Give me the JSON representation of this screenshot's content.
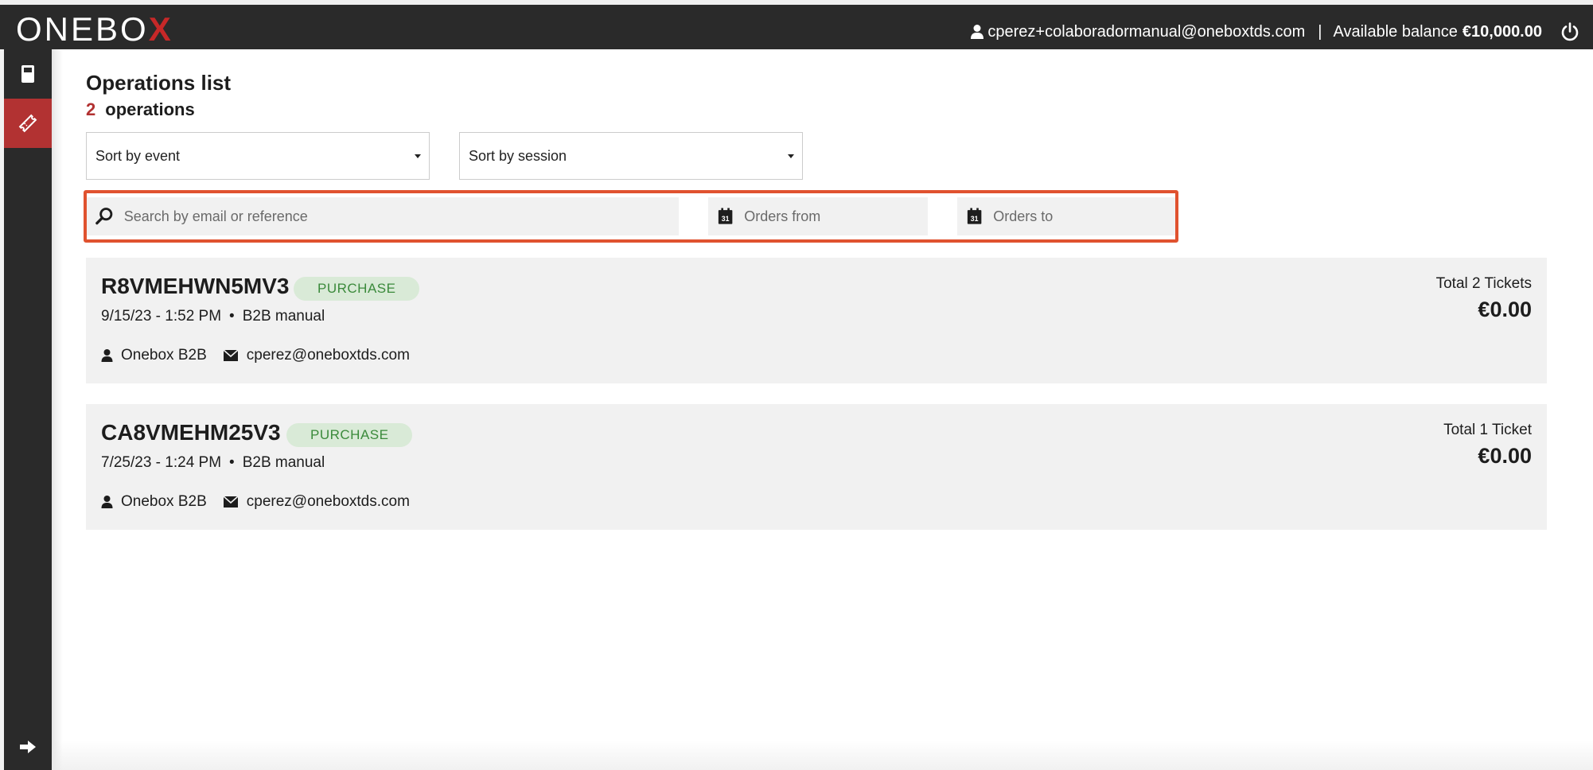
{
  "header": {
    "logo_text": "ONEBO",
    "logo_x": "X",
    "user_email": "cperez+colaboradormanual@oneboxtds.com",
    "separator": "|",
    "balance_label": "Available balance",
    "balance_amount": "€10,000.00"
  },
  "sidebar": {
    "items": [
      {
        "name": "orders-icon",
        "active": false
      },
      {
        "name": "ticket-icon",
        "active": true
      }
    ],
    "bottom": "arrow-right-icon"
  },
  "page": {
    "title": "Operations list",
    "count": "2",
    "count_label": "operations"
  },
  "filters": {
    "sort_event": "Sort by event",
    "sort_session": "Sort by session",
    "search_placeholder": "Search by email or reference",
    "from_placeholder": "Orders from",
    "to_placeholder": "Orders to"
  },
  "operations": [
    {
      "reference": "R8VMEHWN5MV3",
      "type": "PURCHASE",
      "date": "9/15/23 - 1:52 PM",
      "dot": "•",
      "channel": "B2B manual",
      "client": "Onebox B2B",
      "email": "cperez@oneboxtds.com",
      "total_label": "Total 2 Tickets",
      "total_amount": "€0.00"
    },
    {
      "reference": "CA8VMEHM25V3",
      "type": "PURCHASE",
      "date": "7/25/23 - 1:24 PM",
      "dot": "•",
      "channel": "B2B manual",
      "client": "Onebox B2B",
      "email": "cperez@oneboxtds.com",
      "total_label": "Total 1 Ticket",
      "total_amount": "€0.00"
    }
  ],
  "colors": {
    "topbar": "#2a2a2a",
    "accent": "#b23232",
    "highlight": "#e0522f",
    "badge_bg": "#d9ead7",
    "badge_text": "#3b8a3b"
  }
}
